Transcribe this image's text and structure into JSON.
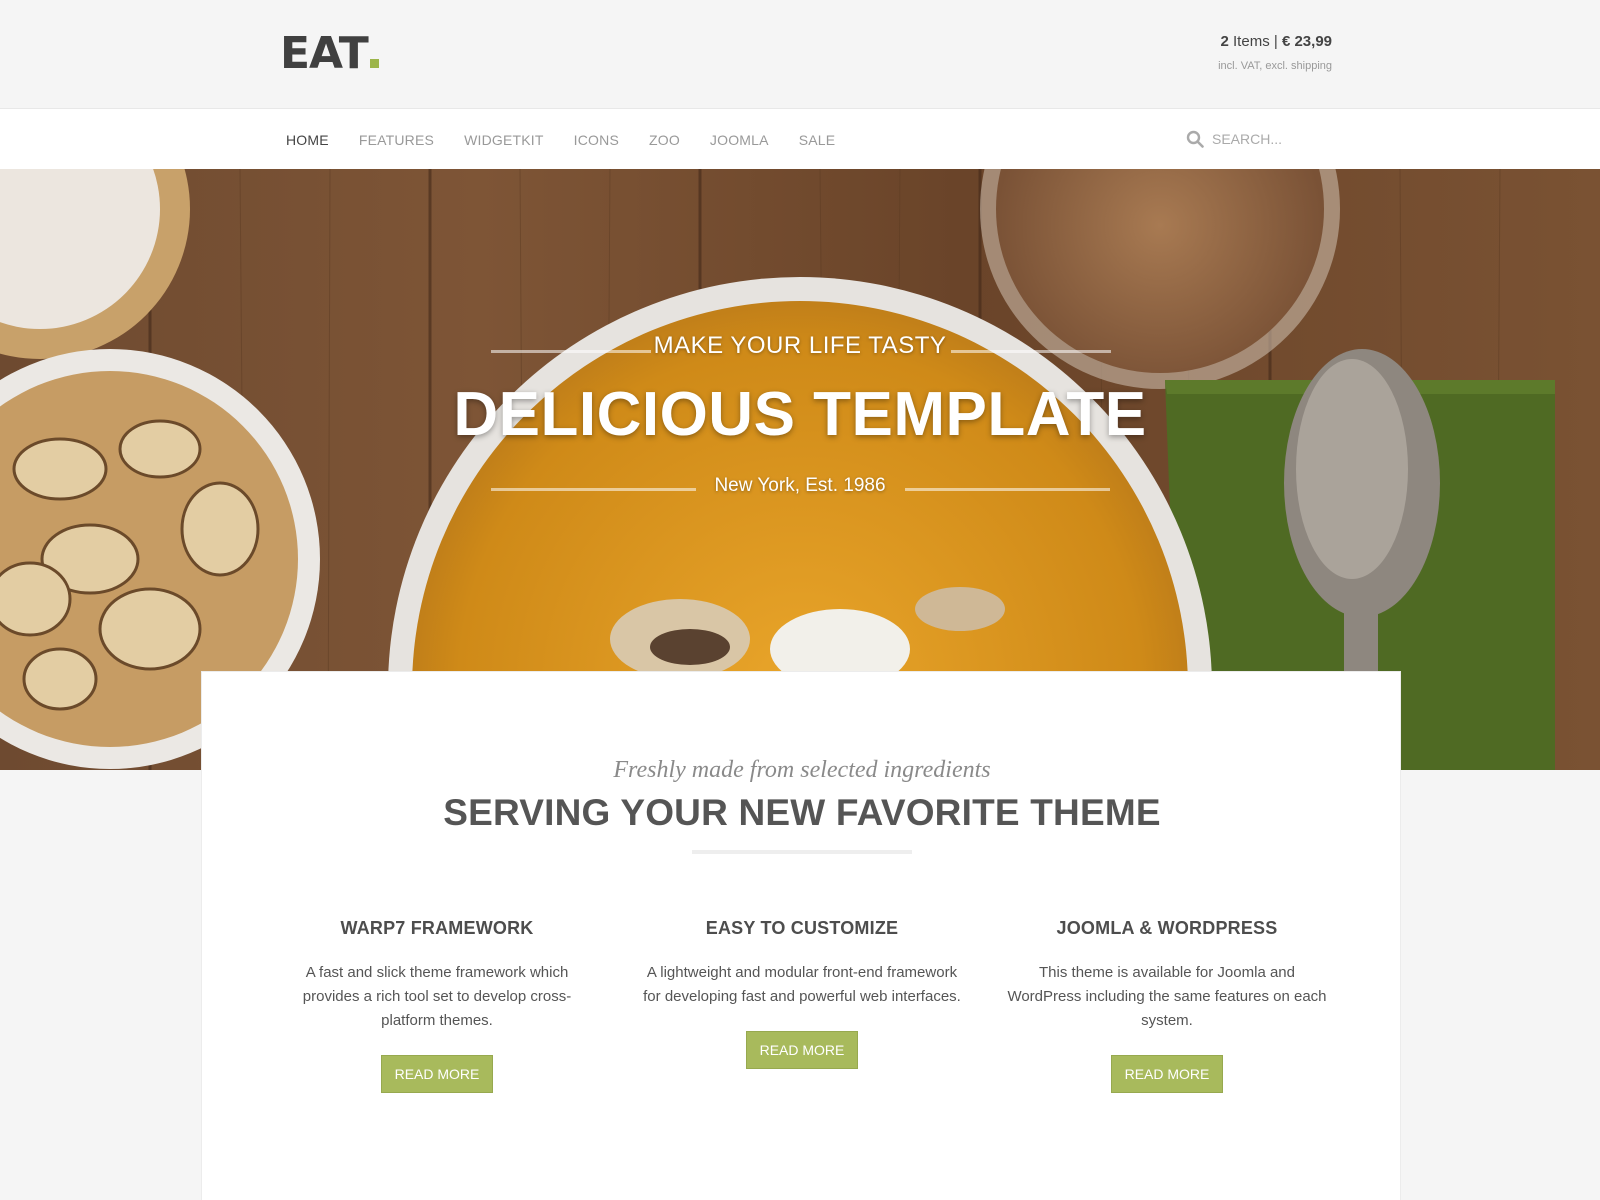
{
  "header": {
    "logo": "EAT",
    "cart": {
      "count": "2",
      "items_label": "Items",
      "separator": "|",
      "price": "€ 23,99",
      "note": "incl. VAT, excl. shipping"
    }
  },
  "nav": {
    "items": [
      {
        "label": "HOME",
        "active": true
      },
      {
        "label": "FEATURES"
      },
      {
        "label": "WIDGETKIT"
      },
      {
        "label": "ICONS"
      },
      {
        "label": "ZOO"
      },
      {
        "label": "JOOMLA"
      },
      {
        "label": "SALE"
      }
    ],
    "search_placeholder": "SEARCH...",
    "search_icon": "search-icon"
  },
  "hero": {
    "subtitle": "MAKE YOUR LIFE TASTY",
    "title": "DELICIOUS TEMPLATE",
    "est": "New York, Est. 1986"
  },
  "intro": {
    "tagline": "Freshly made from selected ingredients",
    "headline": "SERVING YOUR NEW FAVORITE THEME"
  },
  "features": [
    {
      "title": "WARP7 FRAMEWORK",
      "text": "A fast and slick theme framework which provides a rich tool set to develop cross-platform themes.",
      "button": "READ MORE"
    },
    {
      "title": "EASY TO CUSTOMIZE",
      "text": "A lightweight and modular front-end framework for developing fast and powerful web interfaces.",
      "button": "READ MORE"
    },
    {
      "title": "JOOMLA & WORDPRESS",
      "text": "This theme is available for Joomla and WordPress including the same features on each system.",
      "button": "READ MORE"
    }
  ],
  "colors": {
    "accent": "#9cb54a",
    "button": "#a8ba5c"
  }
}
